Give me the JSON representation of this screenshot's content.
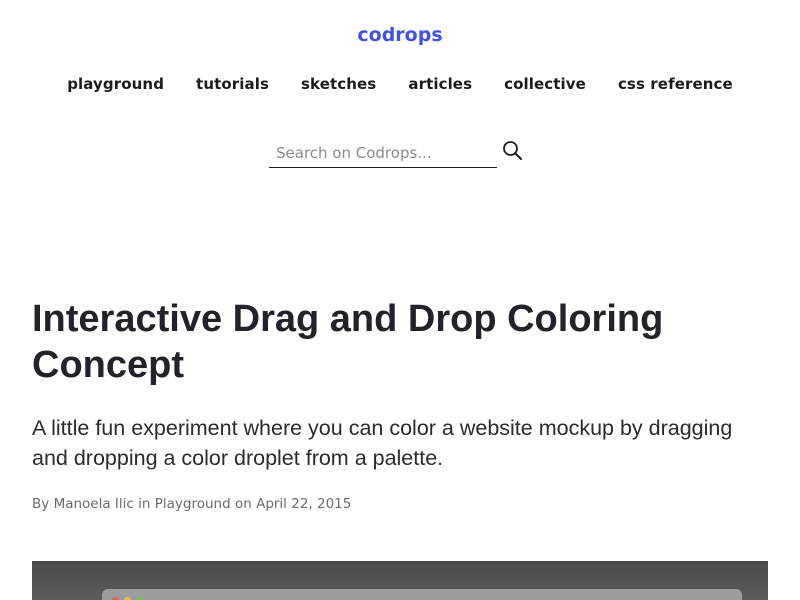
{
  "site": {
    "logo": "codrops"
  },
  "nav": {
    "items": [
      {
        "label": "playground"
      },
      {
        "label": "tutorials"
      },
      {
        "label": "sketches"
      },
      {
        "label": "articles"
      },
      {
        "label": "collective"
      },
      {
        "label": "css reference"
      }
    ]
  },
  "search": {
    "placeholder": "Search on Codrops..."
  },
  "article": {
    "title": "Interactive Drag and Drop Coloring Concept",
    "subtitle": "A little fun experiment where you can color a website mockup by dragging and dropping a color droplet from a palette.",
    "meta": {
      "by": "By",
      "author": "Manoela Ilic",
      "in": "in",
      "category": "Playground",
      "on": "on",
      "date": "April 22, 2015"
    }
  },
  "colors": {
    "brand": "#4052e6",
    "text": "#22232a",
    "meta": "#6a6a70",
    "dot_red": "#e0675d",
    "dot_yellow": "#e8c23f",
    "dot_green": "#72c25a"
  },
  "icons": {
    "search": "search-icon"
  }
}
